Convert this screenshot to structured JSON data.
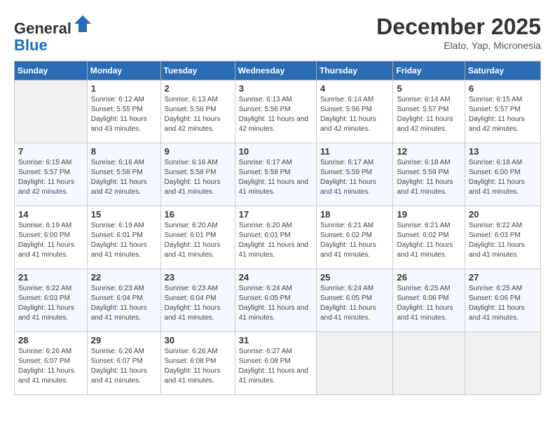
{
  "header": {
    "logo_general": "General",
    "logo_blue": "Blue",
    "month_title": "December 2025",
    "location": "Elato, Yap, Micronesia"
  },
  "days_of_week": [
    "Sunday",
    "Monday",
    "Tuesday",
    "Wednesday",
    "Thursday",
    "Friday",
    "Saturday"
  ],
  "weeks": [
    [
      {
        "day": "",
        "sunrise": "",
        "sunset": "",
        "daylight": "",
        "empty": true
      },
      {
        "day": "1",
        "sunrise": "Sunrise: 6:12 AM",
        "sunset": "Sunset: 5:55 PM",
        "daylight": "Daylight: 11 hours and 43 minutes."
      },
      {
        "day": "2",
        "sunrise": "Sunrise: 6:13 AM",
        "sunset": "Sunset: 5:56 PM",
        "daylight": "Daylight: 11 hours and 42 minutes."
      },
      {
        "day": "3",
        "sunrise": "Sunrise: 6:13 AM",
        "sunset": "Sunset: 5:56 PM",
        "daylight": "Daylight: 11 hours and 42 minutes."
      },
      {
        "day": "4",
        "sunrise": "Sunrise: 6:14 AM",
        "sunset": "Sunset: 5:56 PM",
        "daylight": "Daylight: 11 hours and 42 minutes."
      },
      {
        "day": "5",
        "sunrise": "Sunrise: 6:14 AM",
        "sunset": "Sunset: 5:57 PM",
        "daylight": "Daylight: 11 hours and 42 minutes."
      },
      {
        "day": "6",
        "sunrise": "Sunrise: 6:15 AM",
        "sunset": "Sunset: 5:57 PM",
        "daylight": "Daylight: 11 hours and 42 minutes."
      }
    ],
    [
      {
        "day": "7",
        "sunrise": "Sunrise: 6:15 AM",
        "sunset": "Sunset: 5:57 PM",
        "daylight": "Daylight: 11 hours and 42 minutes."
      },
      {
        "day": "8",
        "sunrise": "Sunrise: 6:16 AM",
        "sunset": "Sunset: 5:58 PM",
        "daylight": "Daylight: 11 hours and 42 minutes."
      },
      {
        "day": "9",
        "sunrise": "Sunrise: 6:16 AM",
        "sunset": "Sunset: 5:58 PM",
        "daylight": "Daylight: 11 hours and 41 minutes."
      },
      {
        "day": "10",
        "sunrise": "Sunrise: 6:17 AM",
        "sunset": "Sunset: 5:58 PM",
        "daylight": "Daylight: 11 hours and 41 minutes."
      },
      {
        "day": "11",
        "sunrise": "Sunrise: 6:17 AM",
        "sunset": "Sunset: 5:59 PM",
        "daylight": "Daylight: 11 hours and 41 minutes."
      },
      {
        "day": "12",
        "sunrise": "Sunrise: 6:18 AM",
        "sunset": "Sunset: 5:59 PM",
        "daylight": "Daylight: 11 hours and 41 minutes."
      },
      {
        "day": "13",
        "sunrise": "Sunrise: 6:18 AM",
        "sunset": "Sunset: 6:00 PM",
        "daylight": "Daylight: 11 hours and 41 minutes."
      }
    ],
    [
      {
        "day": "14",
        "sunrise": "Sunrise: 6:19 AM",
        "sunset": "Sunset: 6:00 PM",
        "daylight": "Daylight: 11 hours and 41 minutes."
      },
      {
        "day": "15",
        "sunrise": "Sunrise: 6:19 AM",
        "sunset": "Sunset: 6:01 PM",
        "daylight": "Daylight: 11 hours and 41 minutes."
      },
      {
        "day": "16",
        "sunrise": "Sunrise: 6:20 AM",
        "sunset": "Sunset: 6:01 PM",
        "daylight": "Daylight: 11 hours and 41 minutes."
      },
      {
        "day": "17",
        "sunrise": "Sunrise: 6:20 AM",
        "sunset": "Sunset: 6:01 PM",
        "daylight": "Daylight: 11 hours and 41 minutes."
      },
      {
        "day": "18",
        "sunrise": "Sunrise: 6:21 AM",
        "sunset": "Sunset: 6:02 PM",
        "daylight": "Daylight: 11 hours and 41 minutes."
      },
      {
        "day": "19",
        "sunrise": "Sunrise: 6:21 AM",
        "sunset": "Sunset: 6:02 PM",
        "daylight": "Daylight: 11 hours and 41 minutes."
      },
      {
        "day": "20",
        "sunrise": "Sunrise: 6:22 AM",
        "sunset": "Sunset: 6:03 PM",
        "daylight": "Daylight: 11 hours and 41 minutes."
      }
    ],
    [
      {
        "day": "21",
        "sunrise": "Sunrise: 6:22 AM",
        "sunset": "Sunset: 6:03 PM",
        "daylight": "Daylight: 11 hours and 41 minutes."
      },
      {
        "day": "22",
        "sunrise": "Sunrise: 6:23 AM",
        "sunset": "Sunset: 6:04 PM",
        "daylight": "Daylight: 11 hours and 41 minutes."
      },
      {
        "day": "23",
        "sunrise": "Sunrise: 6:23 AM",
        "sunset": "Sunset: 6:04 PM",
        "daylight": "Daylight: 11 hours and 41 minutes."
      },
      {
        "day": "24",
        "sunrise": "Sunrise: 6:24 AM",
        "sunset": "Sunset: 6:05 PM",
        "daylight": "Daylight: 11 hours and 41 minutes."
      },
      {
        "day": "25",
        "sunrise": "Sunrise: 6:24 AM",
        "sunset": "Sunset: 6:05 PM",
        "daylight": "Daylight: 11 hours and 41 minutes."
      },
      {
        "day": "26",
        "sunrise": "Sunrise: 6:25 AM",
        "sunset": "Sunset: 6:06 PM",
        "daylight": "Daylight: 11 hours and 41 minutes."
      },
      {
        "day": "27",
        "sunrise": "Sunrise: 6:25 AM",
        "sunset": "Sunset: 6:06 PM",
        "daylight": "Daylight: 11 hours and 41 minutes."
      }
    ],
    [
      {
        "day": "28",
        "sunrise": "Sunrise: 6:26 AM",
        "sunset": "Sunset: 6:07 PM",
        "daylight": "Daylight: 11 hours and 41 minutes."
      },
      {
        "day": "29",
        "sunrise": "Sunrise: 6:26 AM",
        "sunset": "Sunset: 6:07 PM",
        "daylight": "Daylight: 11 hours and 41 minutes."
      },
      {
        "day": "30",
        "sunrise": "Sunrise: 6:26 AM",
        "sunset": "Sunset: 6:08 PM",
        "daylight": "Daylight: 11 hours and 41 minutes."
      },
      {
        "day": "31",
        "sunrise": "Sunrise: 6:27 AM",
        "sunset": "Sunset: 6:08 PM",
        "daylight": "Daylight: 11 hours and 41 minutes."
      },
      {
        "day": "",
        "sunrise": "",
        "sunset": "",
        "daylight": "",
        "empty": true
      },
      {
        "day": "",
        "sunrise": "",
        "sunset": "",
        "daylight": "",
        "empty": true
      },
      {
        "day": "",
        "sunrise": "",
        "sunset": "",
        "daylight": "",
        "empty": true
      }
    ]
  ]
}
